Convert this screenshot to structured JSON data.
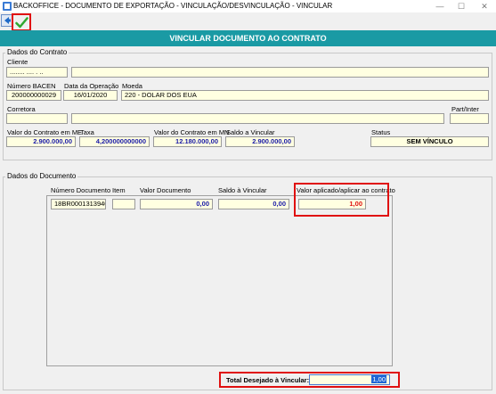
{
  "window": {
    "title": "BACKOFFICE - DOCUMENTO DE EXPORTAÇÃO - VINCULAÇÃO/DESVINCULAÇÃO - VINCULAR",
    "min_glyph": "—",
    "max_glyph": "☐",
    "close_glyph": "✕"
  },
  "toolbar": {
    "back_icon": "back-arrow-icon",
    "confirm_icon": "checkmark-icon"
  },
  "banner": {
    "title": "VINCULAR DOCUMENTO AO CONTRATO"
  },
  "contract": {
    "group_title": "Dados do Contrato",
    "cliente_label": "Cliente",
    "cliente_code": "........ .... . ..",
    "cliente_name": "",
    "numero_bacen_label": "Número BACEN",
    "numero_bacen": "200000000029",
    "data_operacao_label": "Data da Operação",
    "data_operacao": "16/01/2020",
    "moeda_label": "Moeda",
    "moeda": "220 - DOLAR DOS EUA",
    "corretora_label": "Corretora",
    "corretora_code": "",
    "corretora_name": "",
    "part_inter_label": "Part/Inter",
    "part_inter": "",
    "valor_me_label": "Valor do Contrato em ME",
    "valor_me": "2.900.000,00",
    "taxa_label": "Taxa",
    "taxa": "4,200000000000",
    "valor_mn_label": "Valor do Contrato em MN",
    "valor_mn": "12.180.000,00",
    "saldo_label": "Saldo a Vincular",
    "saldo": "2.900.000,00",
    "status_label": "Status",
    "status": "SEM VÍNCULO"
  },
  "document": {
    "group_title": "Dados do Documento",
    "columns": {
      "numero": "Número Documento",
      "item": "Item",
      "valor": "Valor Documento",
      "saldo": "Saldo à Vincular",
      "aplicado": "Valor aplicado/aplicar ao contrato"
    },
    "rows": [
      {
        "numero": "18BR0001313940",
        "item": "",
        "valor": "0,00",
        "saldo": "0,00",
        "aplicado": "1,00"
      }
    ],
    "total_label": "Total Desejado à Vincular:",
    "total_value": "1,00"
  },
  "colors": {
    "banner": "#1a9aa4",
    "field_bg": "#ffffe1",
    "highlight": "#e01010",
    "value_blue": "#1a1aa8"
  }
}
